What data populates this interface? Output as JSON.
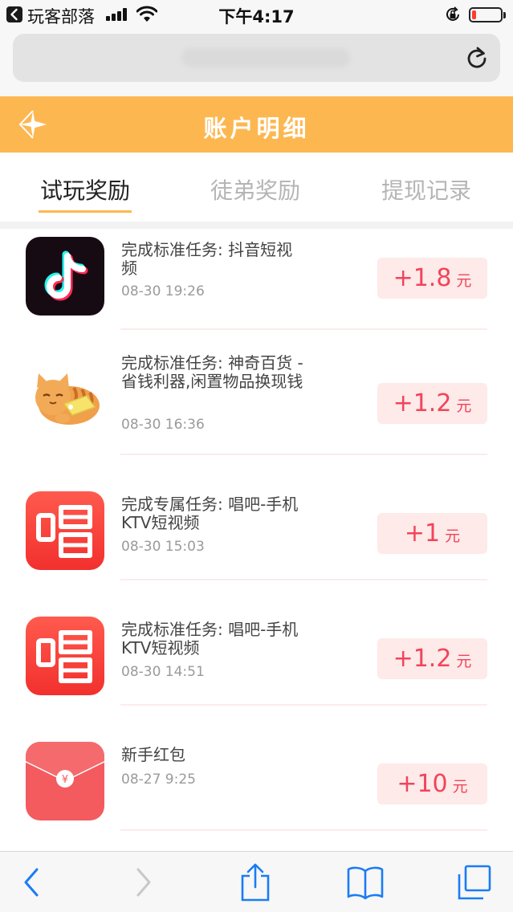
{
  "status_bar": {
    "app_name": "玩客部落",
    "time": "下午4:17",
    "battery_level": 0.15
  },
  "browser": {
    "url": ""
  },
  "header": {
    "title": "账户明细"
  },
  "tabs": [
    {
      "label": "试玩奖励",
      "active": true
    },
    {
      "label": "徒弟奖励",
      "active": false
    },
    {
      "label": "提现记录",
      "active": false
    }
  ],
  "records": [
    {
      "icon": "douyin-app-icon",
      "title": "完成标准任务: 抖音短视频",
      "time": "08-30 19:26",
      "amount": "+1.8",
      "unit": "元"
    },
    {
      "icon": "cat-mascot-icon",
      "title": "完成标准任务: 神奇百货 - 省钱利器,闲置物品换现钱",
      "time": "08-30 16:36",
      "amount": "+1.2",
      "unit": "元"
    },
    {
      "icon": "changba-app-icon",
      "title": "完成专属任务: 唱吧-手机KTV短视频",
      "time": "08-30 15:03",
      "amount": "+1",
      "unit": "元"
    },
    {
      "icon": "changba-app-icon",
      "title": "完成标准任务: 唱吧-手机KTV短视频",
      "time": "08-30 14:51",
      "amount": "+1.2",
      "unit": "元"
    },
    {
      "icon": "red-envelope-icon",
      "title": "新手红包",
      "time": "08-27 9:25",
      "amount": "+10",
      "unit": "元"
    }
  ],
  "colors": {
    "accent": "#fdb751",
    "reward_text": "#f2445a",
    "reward_bg": "#fdeae9"
  }
}
